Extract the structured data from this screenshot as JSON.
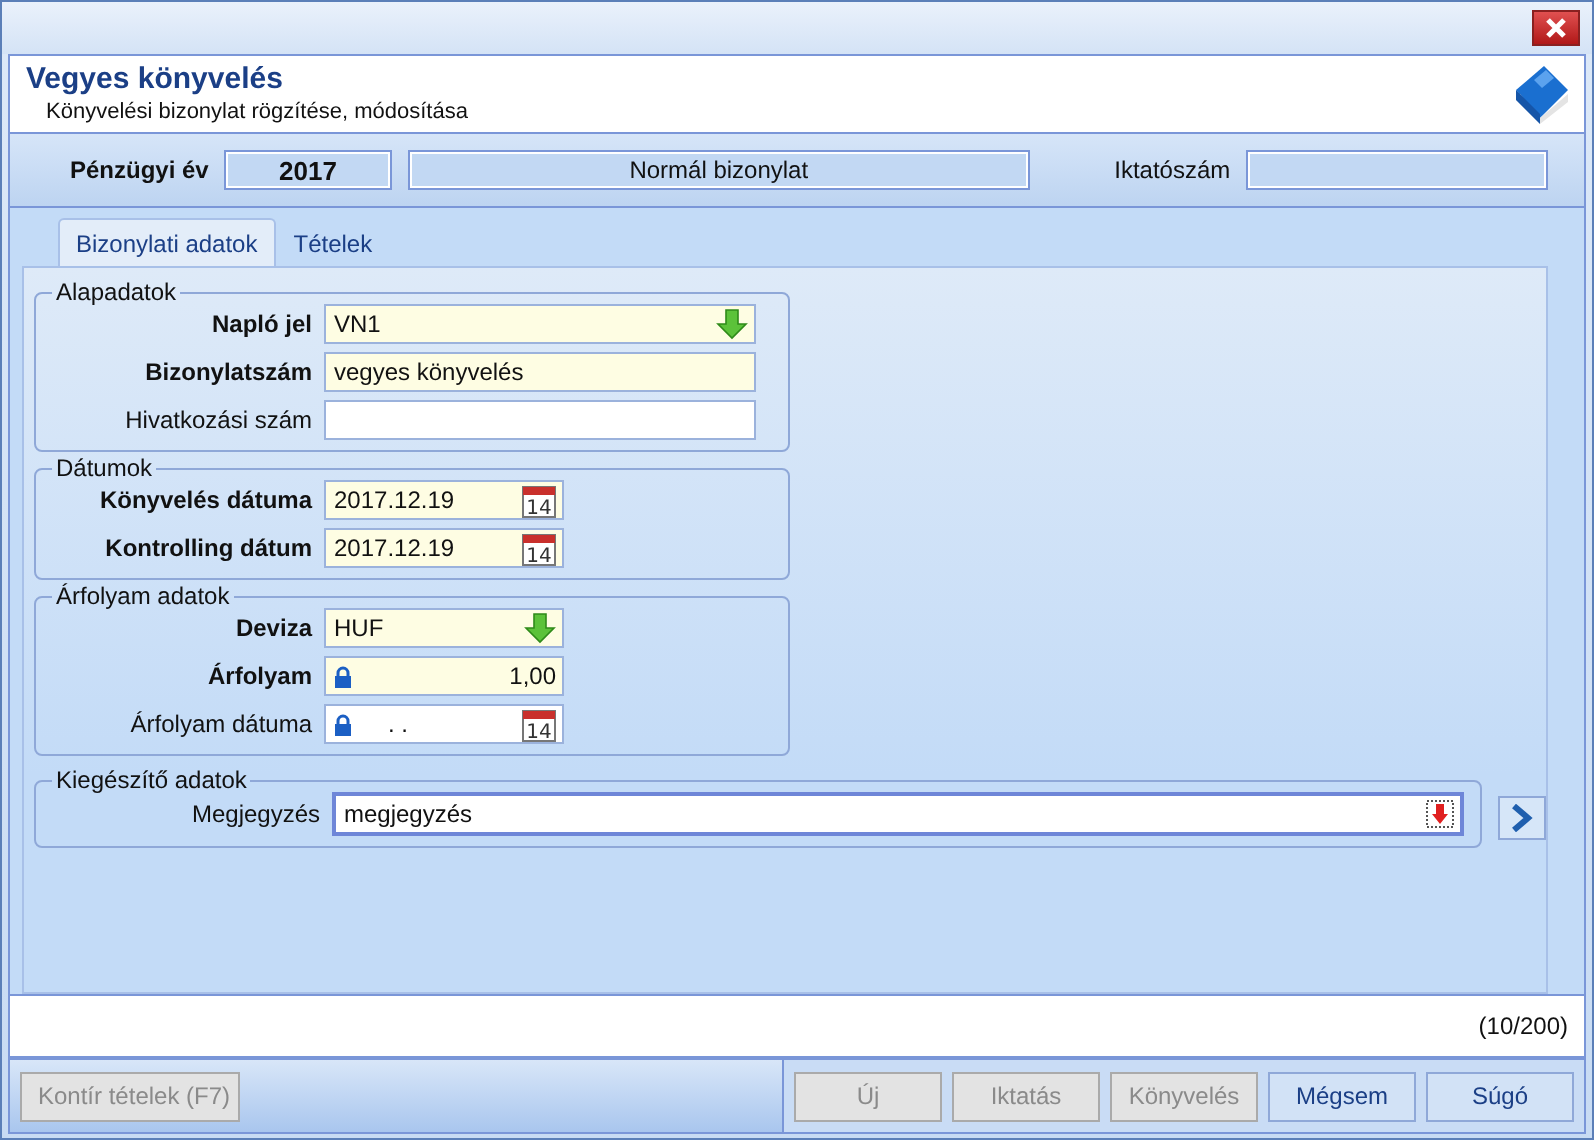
{
  "header": {
    "title": "Vegyes könyvelés",
    "subtitle": "Könyvelési bizonylat rögzítése, módosítása"
  },
  "info_bar": {
    "year_label": "Pénzügyi év",
    "year": "2017",
    "type": "Normál bizonylat",
    "number_label": "Iktatószám"
  },
  "tabs": [
    {
      "label": "Bizonylati adatok",
      "selected": true
    },
    {
      "label": "Tételek",
      "selected": false
    }
  ],
  "groups": [
    {
      "title": "Alapadatok",
      "fields": [
        {
          "label": "Napló jel",
          "value": "VN1",
          "required": true,
          "kind": "dropdown"
        },
        {
          "label": "Bizonylatszám",
          "value": "vegyes könyvelés",
          "required": true,
          "kind": "text"
        },
        {
          "label": "Hivatkozási szám",
          "required": false,
          "kind": "text"
        }
      ]
    },
    {
      "title": "Dátumok",
      "fields": [
        {
          "label": "Könyvelés dátuma",
          "value": "2017.12.19",
          "required": true,
          "kind": "date",
          "calendar_day": "14"
        },
        {
          "label": "Kontrolling dátum",
          "value": "2017.12.19",
          "required": true,
          "kind": "date",
          "calendar_day": "14"
        }
      ]
    },
    {
      "title": "Árfolyam adatok",
      "fields": [
        {
          "label": "Deviza",
          "value": "HUF",
          "required": true,
          "kind": "dropdown"
        },
        {
          "label": "Árfolyam",
          "value": "1,00",
          "required": true,
          "kind": "locked-number"
        },
        {
          "label": "Árfolyam dátuma",
          "value": ". .",
          "required": false,
          "kind": "locked-date",
          "calendar_day": "14"
        }
      ]
    }
  ],
  "extra": {
    "title": "Kiegészítő adatok",
    "label": "Megjegyzés",
    "value": "megjegyzés"
  },
  "counter": "(10/200)",
  "buttons_left": [
    {
      "label": "Kontír tételek (F7)",
      "disabled": true
    }
  ],
  "buttons_right": [
    {
      "label": "Új",
      "disabled": true
    },
    {
      "label": "Iktatás",
      "disabled": true
    },
    {
      "label": "Könyvelés",
      "disabled": true
    },
    {
      "label": "Mégsem",
      "disabled": false
    },
    {
      "label": "Súgó",
      "disabled": false
    }
  ]
}
